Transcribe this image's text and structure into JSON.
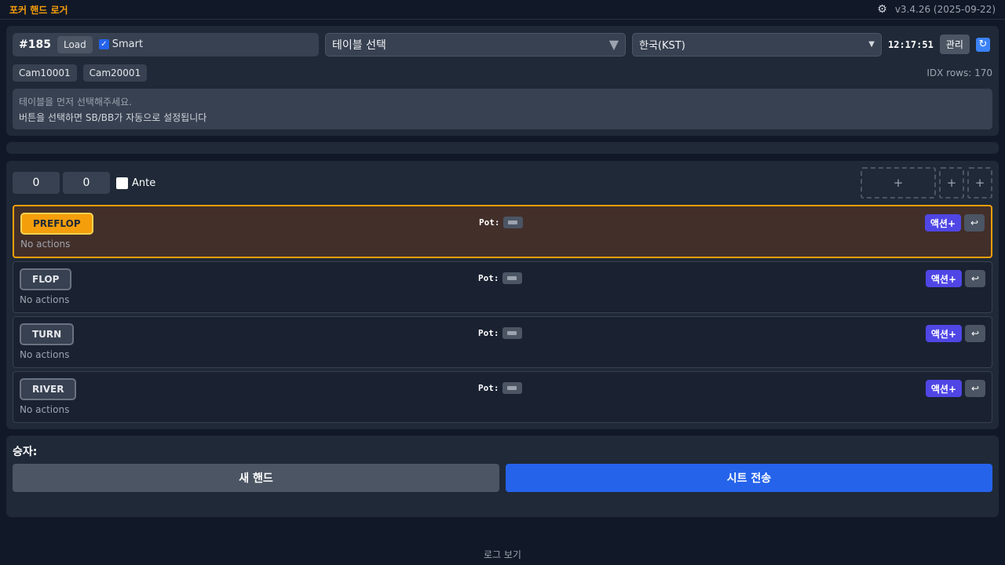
{
  "header": {
    "title": "포커 핸드 로거",
    "settings_icon": "gear-icon",
    "version": "v3.4.26 (2025-09-22)"
  },
  "top_panel": {
    "hand_number": "#185",
    "load_label": "Load",
    "smart_label": "Smart",
    "smart_checked": true,
    "table_select": "테이블 선택",
    "timezone_select": "한국(KST)",
    "clock": "12:17:51",
    "manage_label": "관리",
    "refresh_icon": "refresh-icon",
    "cams": [
      "Cam10001",
      "Cam20001"
    ],
    "idx_rows": "IDX rows: 170",
    "hint_line1": "테이블을 먼저 선택해주세요.",
    "hint_line2": "버튼을 선택하면 SB/BB가 자동으로 설정됩니다"
  },
  "blinds": {
    "sb_value": "0",
    "bb_value": "0",
    "ante_label": "Ante",
    "ante_checked": false,
    "plus_label": "+"
  },
  "streets": [
    {
      "name": "PREFLOP",
      "pot_label": "Pot:",
      "empty_text": "No actions",
      "active": true
    },
    {
      "name": "FLOP",
      "pot_label": "Pot:",
      "empty_text": "No actions",
      "active": false
    },
    {
      "name": "TURN",
      "pot_label": "Pot:",
      "empty_text": "No actions",
      "active": false
    },
    {
      "name": "RIVER",
      "pot_label": "Pot:",
      "empty_text": "No actions",
      "active": false
    }
  ],
  "street_buttons": {
    "action_label": "액션+",
    "undo_label": "↩"
  },
  "footer_panel": {
    "winner_label": "승자:",
    "new_hand_label": "새 핸드",
    "send_sheet_label": "시트 전송"
  },
  "log_link": "로그 보기",
  "colors": {
    "accent": "#f59e0b",
    "primary": "#2563eb",
    "action": "#4f46e5",
    "background": "#111827",
    "panel": "#1f2937"
  }
}
